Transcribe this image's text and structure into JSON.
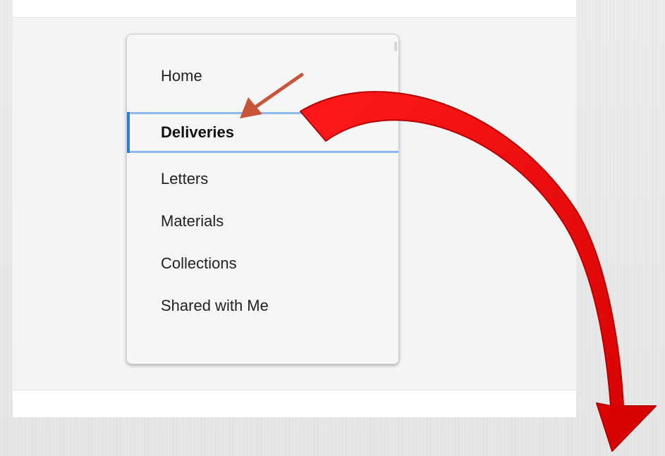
{
  "menu": {
    "items": [
      {
        "label": "Home",
        "active": false
      },
      {
        "label": "Deliveries",
        "active": true
      },
      {
        "label": "Letters",
        "active": false
      },
      {
        "label": "Materials",
        "active": false
      },
      {
        "label": "Collections",
        "active": false
      },
      {
        "label": "Shared with Me",
        "active": false
      }
    ]
  },
  "colors": {
    "active_outline": "#8bb9f0",
    "active_bar": "#2e7bd6",
    "small_arrow": "#c8553a",
    "big_arrow": "#e00000"
  },
  "annotations": [
    {
      "type": "arrow",
      "icon": "small-pointer-arrow-icon",
      "points_to": "Deliveries"
    },
    {
      "type": "arrow",
      "icon": "large-curved-arrow-icon",
      "from": "Deliveries",
      "direction": "down-right"
    }
  ]
}
